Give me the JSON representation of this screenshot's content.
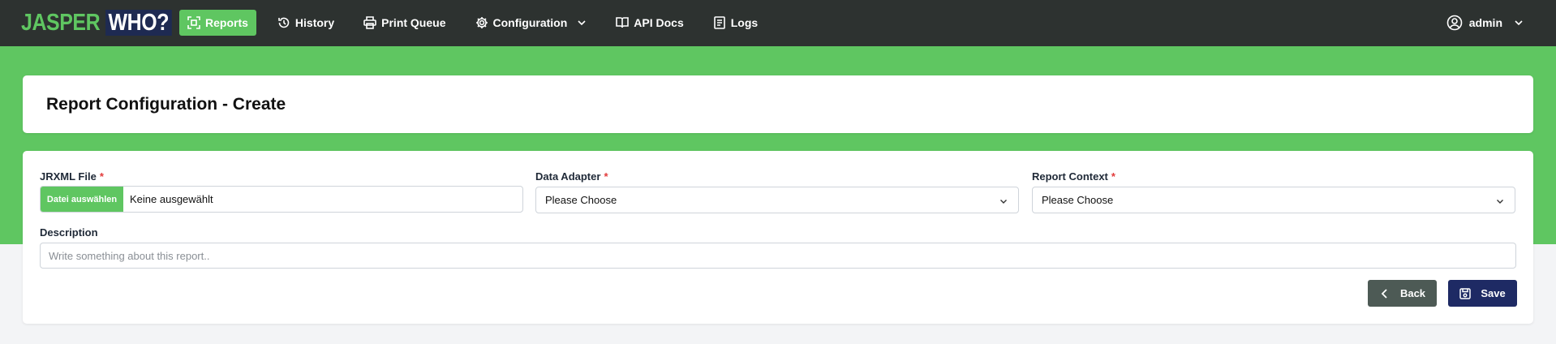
{
  "logo": {
    "part1": "JASPER",
    "part2": "WHO?"
  },
  "nav": {
    "items": [
      {
        "label": "Reports",
        "icon": "reports-icon",
        "active": true
      },
      {
        "label": "History",
        "icon": "history-icon"
      },
      {
        "label": "Print Queue",
        "icon": "printer-icon"
      },
      {
        "label": "Configuration",
        "icon": "gear-icon",
        "dropdown": true
      },
      {
        "label": "API Docs",
        "icon": "book-icon"
      },
      {
        "label": "Logs",
        "icon": "logs-icon"
      }
    ],
    "user": {
      "label": "admin",
      "icon": "user-circle-icon"
    }
  },
  "page": {
    "title": "Report Configuration - Create"
  },
  "form": {
    "jrxml": {
      "label": "JRXML File",
      "required": "*",
      "button": "Datei auswählen",
      "value": "Keine ausgewählt"
    },
    "adapter": {
      "label": "Data Adapter",
      "required": "*",
      "value": "Please Choose"
    },
    "context": {
      "label": "Report Context",
      "required": "*",
      "value": "Please Choose"
    },
    "description": {
      "label": "Description",
      "placeholder": "Write something about this report.."
    }
  },
  "actions": {
    "back": "Back",
    "save": "Save"
  },
  "colors": {
    "navbar": "#2d3230",
    "accent": "#5fc661",
    "brand_dark": "#1e2a64",
    "back_button": "#4d5a55",
    "required": "#e23b3b"
  }
}
